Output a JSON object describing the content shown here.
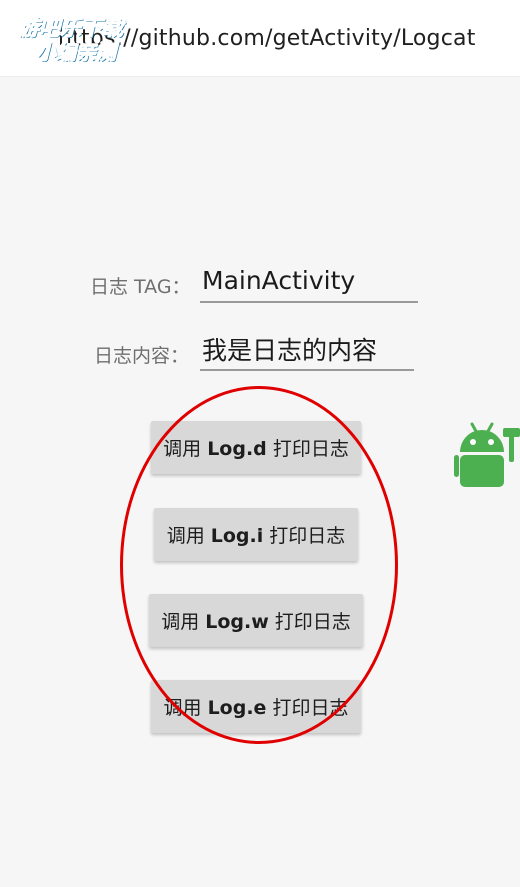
{
  "topbar": {
    "url": "https://github.com/getActivity/Logcat",
    "watermark_line1": "游吧乐下载",
    "watermark_line2": "小编亲测"
  },
  "form": {
    "tag_label": "日志 TAG：",
    "tag_value": "MainActivity",
    "content_label": "日志内容：",
    "content_value": "我是日志的内容"
  },
  "buttons": [
    {
      "prefix": "调用 ",
      "method": "Log.d",
      "suffix": " 打印日志"
    },
    {
      "prefix": "调用 ",
      "method": "Log.i",
      "suffix": " 打印日志"
    },
    {
      "prefix": "调用 ",
      "method": "Log.w",
      "suffix": " 打印日志"
    },
    {
      "prefix": "调用 ",
      "method": "Log.e",
      "suffix": " 打印日志"
    }
  ],
  "colors": {
    "annotation_circle": "#e00000",
    "android_icon": "#4caf50",
    "watermark": "#1ec3f0"
  },
  "icons": {
    "floating": "android-robot-icon"
  }
}
